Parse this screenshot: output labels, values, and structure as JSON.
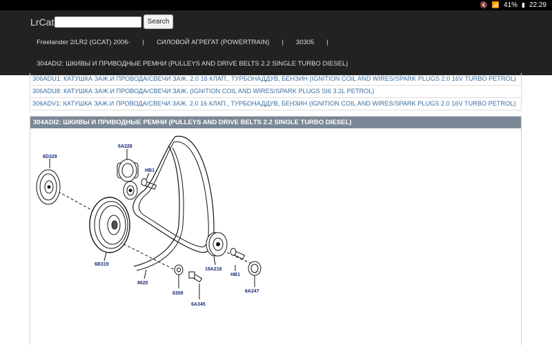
{
  "status_bar": {
    "battery": "41%",
    "time": "22:29"
  },
  "navbar": {
    "brand": "LrCat",
    "search_placeholder": "",
    "search_button": "Search",
    "breadcrumbs": [
      "Freelander 2/LR2 (GCAT) 2006-",
      "СИЛОВОЙ АГРЕГАТ (POWERTRAIN)",
      "30305"
    ],
    "separator": "|",
    "subtitle": "304ADI2: ШКИВЫ И ПРИВОДНЫЕ РЕМНИ (PULLEYS AND DRIVE BELTS 2.2 SINGLE TURBO DIESEL)"
  },
  "links": [
    "306ADU1: КАТУШКА ЗАЖ.И ПРОВОДА/СВЕЧИ ЗАЖ. 2.0 16 КЛАП., ТУРБОНАДДУВ, БЕНЗИН (IGNITION COIL AND WIRES/SPARK PLUGS 2.0 16V TURBO PETROL)",
    "306ADU8: КАТУШКА ЗАЖ.И ПРОВОДА/СВЕЧИ ЗАЖ. (IGNITION COIL AND WIRES/SPARK PLUGS SI6 3.2L PETROL)",
    "306ADV1: КАТУШКА ЗАЖ.И ПРОВОДА/СВЕЧИ ЗАЖ. 2.0 16 КЛАП., ТУРБОНАДДУВ, БЕНЗИН (IGNITION COIL AND WIRES/SPARK PLUGS 2.0 16V TURBO PETROL)"
  ],
  "panel": {
    "title": "304ADI2: ШКИВЫ И ПРИВОДНЫЕ РЕМНИ (PULLEYS AND DRIVE BELTS 2.2 SINGLE TURBO DIESEL)"
  },
  "diagram_labels": {
    "p6D329": "6D329",
    "p6A228": "6A228",
    "pHB1a": "HB1",
    "p6B319": "6B319",
    "p8620": "8620",
    "p19A216": "19A216",
    "pHB1b": "HB1",
    "p6359": "6359",
    "p6A345": "6A345",
    "p6A247": "6A247"
  }
}
